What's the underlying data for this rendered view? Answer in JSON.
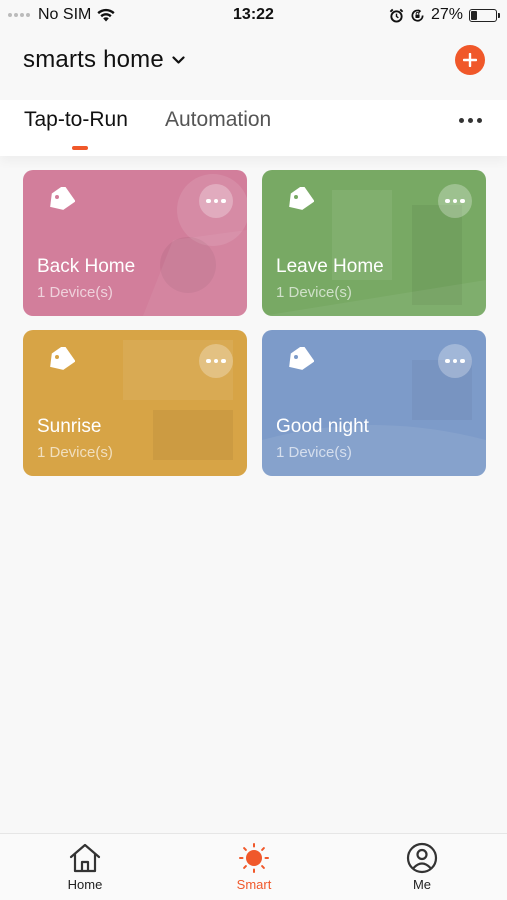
{
  "status_bar": {
    "carrier": "No SIM",
    "time": "13:22",
    "battery": "27%",
    "battery_level": 0.27
  },
  "header": {
    "home_name": "smarts home"
  },
  "tabs": {
    "active": "Tap-to-Run",
    "inactive": "Automation"
  },
  "scenes": [
    {
      "title": "Back Home",
      "subtitle": "1 Device(s)",
      "color": "#d27e9b"
    },
    {
      "title": "Leave Home",
      "subtitle": "1 Device(s)",
      "color": "#78a964"
    },
    {
      "title": "Sunrise",
      "subtitle": "1 Device(s)",
      "color": "#d7a446"
    },
    {
      "title": "Good night",
      "subtitle": "1 Device(s)",
      "color": "#7d9bc9"
    }
  ],
  "bottom_nav": {
    "home": "Home",
    "smart": "Smart",
    "me": "Me"
  },
  "colors": {
    "accent": "#f0582a"
  },
  "icons": {
    "wifi": "wifi-icon",
    "alarm": "alarm-clock-icon",
    "orientation_lock": "orientation-lock-icon",
    "battery": "battery-icon",
    "chevron": "chevron-down-icon",
    "add": "plus-icon",
    "more": "more-horizontal-icon",
    "tag": "tag-icon",
    "home": "home-icon",
    "smart": "sun-icon",
    "me": "person-icon"
  }
}
